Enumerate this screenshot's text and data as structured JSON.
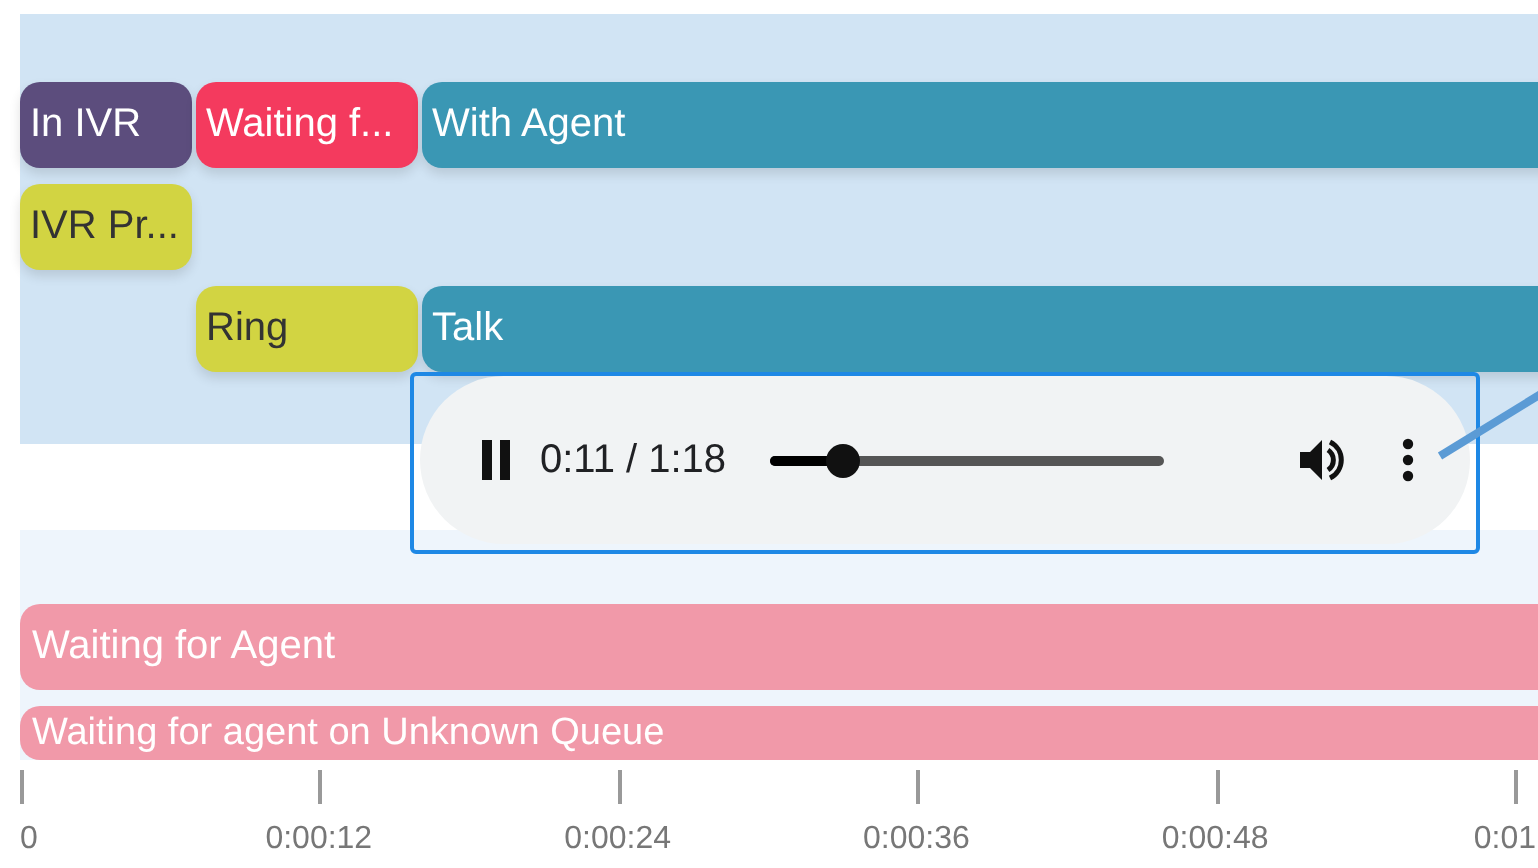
{
  "lanes": [
    {
      "segments": [
        {
          "kind": "ivr",
          "label": "In IVR"
        },
        {
          "kind": "waiting",
          "label": "Waiting f..."
        },
        {
          "kind": "agent",
          "label": "With Agent"
        }
      ]
    },
    {
      "segments": [
        {
          "kind": "prompt",
          "label": "IVR Pr..."
        }
      ]
    },
    {
      "segments": [
        {
          "kind": "ring",
          "label": "Ring"
        },
        {
          "kind": "talk",
          "label": "Talk"
        }
      ]
    }
  ],
  "player": {
    "playing": true,
    "time": "0:11 / 1:18",
    "level": 0.18
  },
  "queue_bars": [
    {
      "label": "Waiting for Agent"
    },
    {
      "label": "Waiting for agent on Unknown Queue"
    }
  ],
  "axis": {
    "ticks": [
      "0",
      "0:00:12",
      "0:00:24",
      "0:00:36",
      "0:00:48",
      "0:01"
    ]
  }
}
